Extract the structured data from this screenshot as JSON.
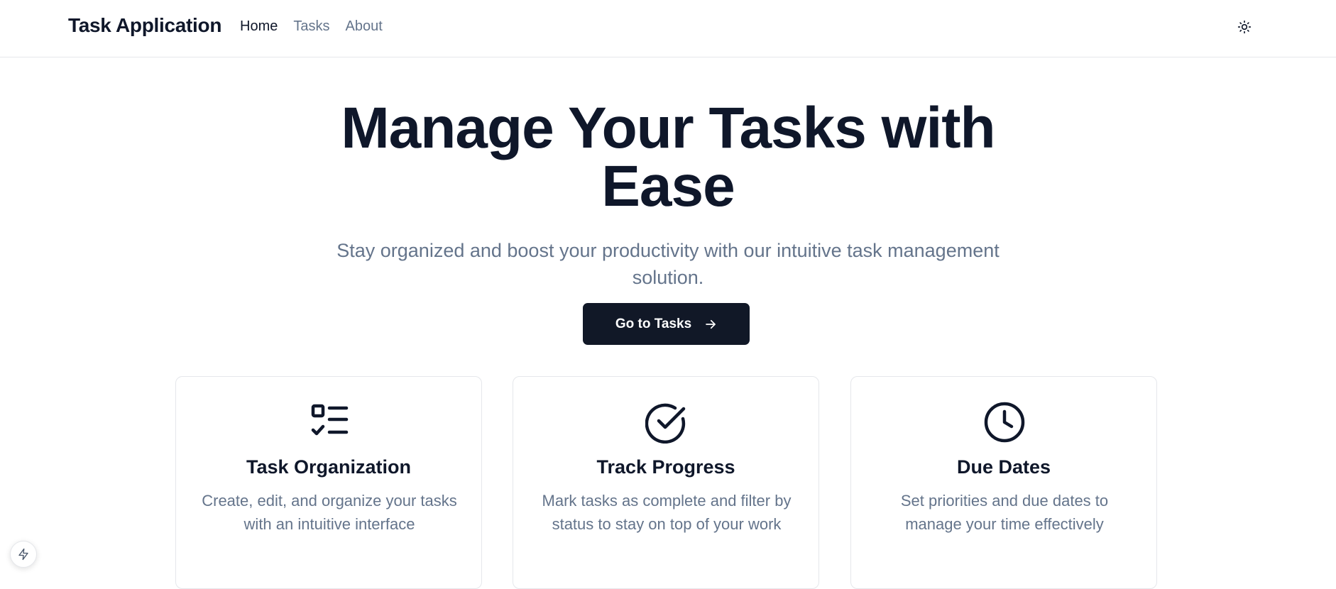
{
  "nav": {
    "brand": "Task Application",
    "links": [
      {
        "label": "Home",
        "active": true
      },
      {
        "label": "Tasks",
        "active": false
      },
      {
        "label": "About",
        "active": false
      }
    ],
    "theme_toggle_icon": "sun-icon"
  },
  "hero": {
    "title": "Manage Your Tasks with Ease",
    "subtitle": "Stay organized and boost your productivity with our intuitive task management solution.",
    "cta_label": "Go to Tasks",
    "cta_icon": "arrow-right-icon"
  },
  "features": [
    {
      "icon": "list-checks-icon",
      "title": "Task Organization",
      "description": "Create, edit, and organize your tasks with an intuitive interface"
    },
    {
      "icon": "circle-check-icon",
      "title": "Track Progress",
      "description": "Mark tasks as complete and filter by status to stay on top of your work"
    },
    {
      "icon": "clock-icon",
      "title": "Due Dates",
      "description": "Set priorities and due dates to manage your time effectively"
    }
  ],
  "colors": {
    "primary": "#111827",
    "text": "#0f172a",
    "muted": "#64748b",
    "border": "#e5e7eb"
  }
}
